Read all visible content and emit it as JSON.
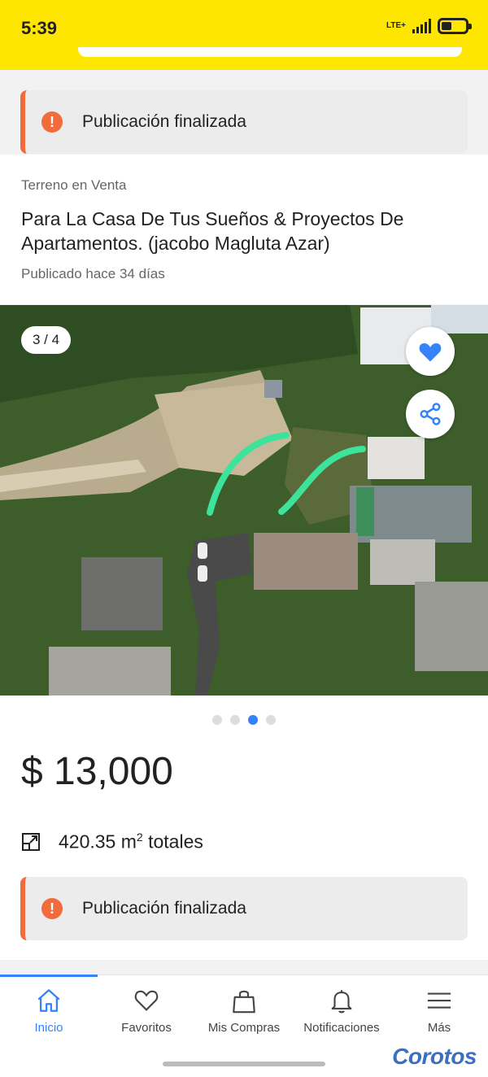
{
  "status_bar": {
    "time": "5:39",
    "network": "LTE+"
  },
  "banner": {
    "text": "Publicación finalizada"
  },
  "listing": {
    "category": "Terreno en Venta",
    "title": "Para La Casa De Tus Sueños & Proyectos De Apartamentos. (jacobo Magluta Azar)",
    "published": "Publicado hace 34 días"
  },
  "gallery": {
    "counter": "3 / 4",
    "current": 3,
    "total": 4
  },
  "price": "$ 13,000",
  "area": {
    "value": "420.35 m",
    "exponent": "2",
    "suffix": " totales"
  },
  "banner_bottom": {
    "text": "Publicación finalizada"
  },
  "tabs": [
    {
      "label": "Inicio",
      "icon": "home-icon",
      "active": true
    },
    {
      "label": "Favoritos",
      "icon": "heart-icon"
    },
    {
      "label": "Mis Compras",
      "icon": "shopping-bag-icon"
    },
    {
      "label": "Notificaciones",
      "icon": "bell-icon"
    },
    {
      "label": "Más",
      "icon": "menu-icon"
    }
  ],
  "brand": "Corotos",
  "colors": {
    "header": "#ffe600",
    "accent": "#3483fa",
    "warning": "#f26b3a"
  }
}
